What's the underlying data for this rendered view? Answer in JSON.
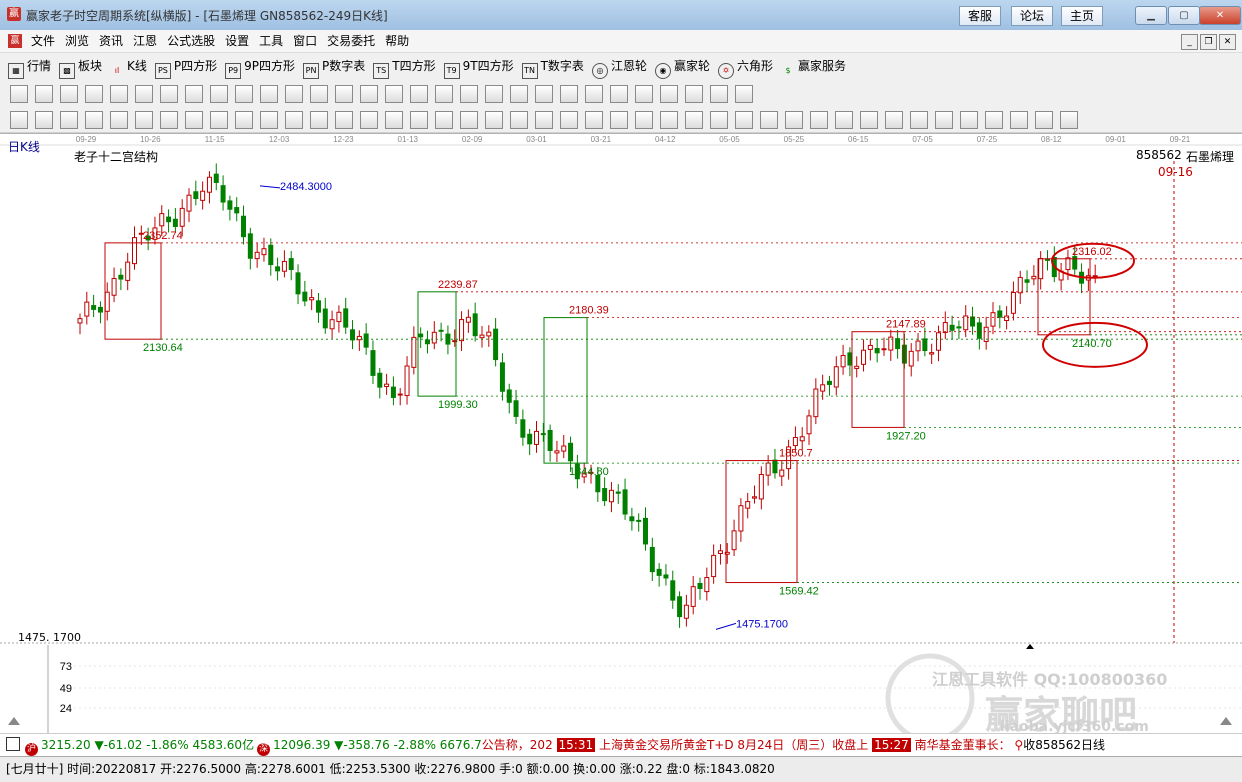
{
  "window": {
    "title": "赢家老子时空周期系统[纵横版] - [石墨烯理  GN858562-249日K线]",
    "buttons": [
      "客服",
      "论坛",
      "主页"
    ]
  },
  "menu": [
    "文件",
    "浏览",
    "资讯",
    "江恩",
    "公式选股",
    "设置",
    "工具",
    "窗口",
    "交易委托",
    "帮助"
  ],
  "toolbar1": [
    {
      "icon": "quote-icon",
      "label": "行情"
    },
    {
      "icon": "block-icon",
      "label": "板块"
    },
    {
      "icon": "kline-icon",
      "label": "K线"
    },
    {
      "icon": "p-square-icon",
      "label": "P四方形"
    },
    {
      "icon": "9p-square-icon",
      "label": "9P四方形"
    },
    {
      "icon": "p-number-icon",
      "label": "P数字表"
    },
    {
      "icon": "t-square-icon",
      "label": "T四方形"
    },
    {
      "icon": "9t-square-icon",
      "label": "9T四方形"
    },
    {
      "icon": "t-number-icon",
      "label": "T数字表"
    },
    {
      "icon": "gann-wheel-icon",
      "label": "江恩轮"
    },
    {
      "icon": "winner-wheel-icon",
      "label": "赢家轮"
    },
    {
      "icon": "hexagon-icon",
      "label": "六角形"
    },
    {
      "icon": "service-icon",
      "label": "赢家服务"
    }
  ],
  "chart": {
    "period_label": "日K线",
    "indicator_name": "老子十二宫结构",
    "stock_code": "858562",
    "stock_name": "石墨烯理",
    "cursor_date": "09-16",
    "x_dates": [
      "09-29",
      "10-26",
      "11-15",
      "12-03",
      "12-23",
      "01-13",
      "02-09",
      "03-01",
      "03-21",
      "04-12",
      "05-05",
      "05-25",
      "06-15",
      "07-05",
      "07-25",
      "08-12",
      "09-01",
      "09-21"
    ],
    "y_low_label": "1475. 1700",
    "volume_ticks": [
      "73",
      "49",
      "24"
    ],
    "peak_label": "2484.3000",
    "trough_label": "1475.1700",
    "boxes": [
      {
        "high": "2352.74",
        "low": "2130.64",
        "color": "#c00000"
      },
      {
        "high": "2239.87",
        "low": "1999.30",
        "color": "#008000"
      },
      {
        "high": "2180.39",
        "low": "1844.80",
        "color": "#008000"
      },
      {
        "high": "1850.7",
        "low": "1569.42",
        "color": "#c00000"
      },
      {
        "high": "2147.89",
        "low": "1927.20",
        "color": "#c00000"
      },
      {
        "high": "2316.02",
        "low": "2140.70",
        "color": "#c00000"
      }
    ],
    "watermark": "江恩工具软件  QQ:100800360",
    "logo_text": "赢家聊吧",
    "logo_url": "liaoba.yjcf360.com"
  },
  "chart_data": {
    "type": "candlestick",
    "title": "老子十二宫结构",
    "x_dates": [
      "09-29",
      "10-26",
      "11-15",
      "12-03",
      "12-23",
      "01-13",
      "02-09",
      "03-01",
      "03-21",
      "04-12",
      "05-05",
      "05-25",
      "06-15",
      "07-05",
      "07-25",
      "08-12",
      "09-01",
      "09-21"
    ],
    "key_levels": [
      2484.3,
      2352.74,
      2316.02,
      2239.87,
      2180.39,
      2147.89,
      2140.7,
      2130.64,
      1999.3,
      1927.2,
      1850.7,
      1844.8,
      1569.42,
      1475.17
    ],
    "path": [
      2160,
      2230,
      2330,
      2370,
      2430,
      2484.3,
      2450,
      2360,
      2300,
      2250,
      2200,
      2150,
      2080,
      2000,
      2120,
      2140,
      2180,
      2100,
      1950,
      1900,
      1850,
      1830,
      1760,
      1700,
      1600,
      1480,
      1600,
      1700,
      1780,
      1850,
      1950,
      2030,
      2100,
      2120,
      2080,
      2130,
      2160,
      2140,
      2200,
      2250,
      2300,
      2316,
      2240
    ]
  },
  "status_ticker": {
    "idx1_value": "3215.20",
    "idx1_change": "▼-61.02 -1.86% 4583.60亿",
    "idx2_value": "12096.39",
    "idx2_change": "▼-358.76 -2.88% 6676.7",
    "news1": "公告称，202",
    "time1": "15:31",
    "news2": "上海黄金交易所黄金T+D 8月24日（周三）收盘上",
    "time2": "15:27",
    "news3": "南华基金董事长：",
    "close_label": "收858562日线"
  },
  "status_info": "[七月廿十] 时间:20220817 开:2276.5000 高:2278.6001 低:2253.5300 收:2276.9800 手:0 额:0.00 换:0.00 涨:0.22 盘:0 标:1843.0820"
}
